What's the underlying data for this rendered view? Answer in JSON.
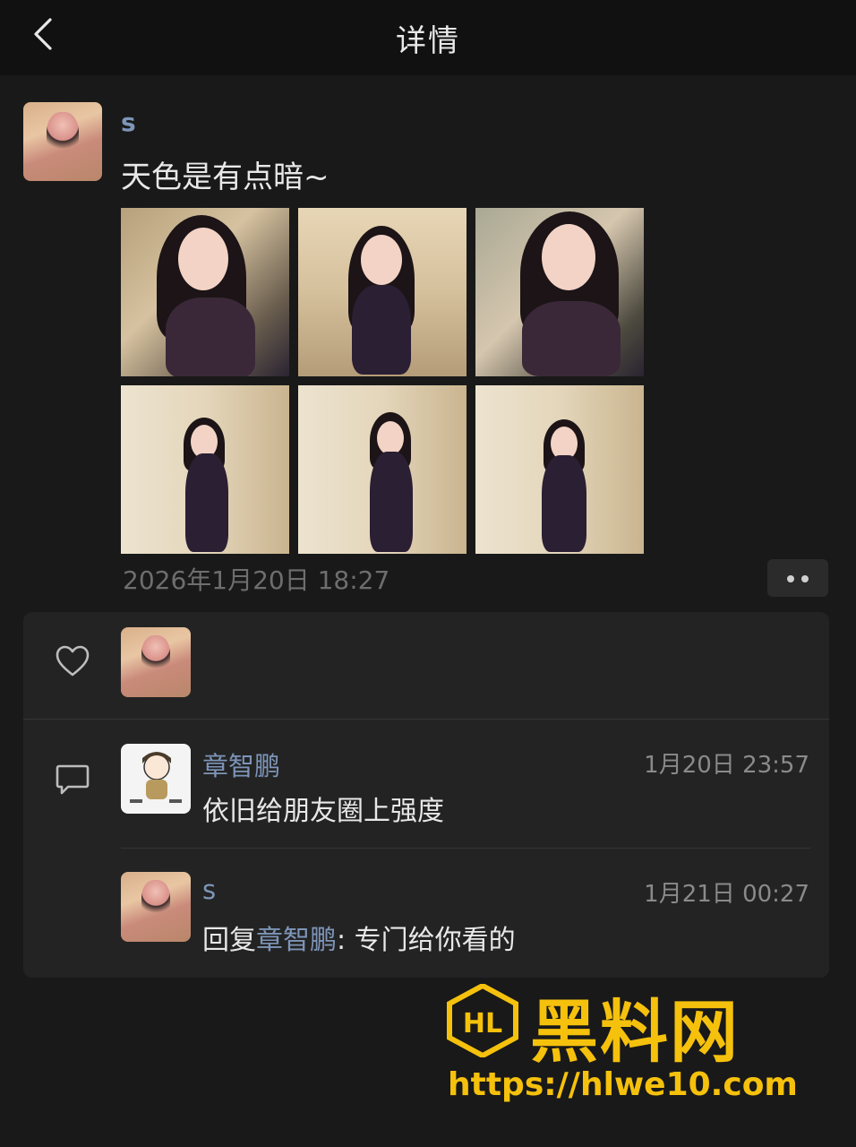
{
  "header": {
    "title": "详情",
    "back_icon": "chevron-left-icon"
  },
  "post": {
    "author": "s",
    "text": "天色是有点暗~",
    "photo_count": 6,
    "timestamp": "2026年1月20日 18:27",
    "more_icon": "more-dots-icon"
  },
  "interactions": {
    "like_icon": "heart-outline-icon",
    "comment_icon": "comment-bubble-icon",
    "comments": [
      {
        "author": "章智鹏",
        "time": "1月20日 23:57",
        "text": "依旧给朋友圈上强度"
      },
      {
        "author": "s",
        "time": "1月21日 00:27",
        "reply_prefix": "回复",
        "reply_to": "章智鹏",
        "reply_sep": ": ",
        "text": "专门给你看的"
      }
    ]
  },
  "watermark": {
    "title": "黑料网",
    "url": "https://hlwe10.com",
    "color": "#f5c10c"
  },
  "colors": {
    "background": "#191919",
    "name_link": "#7d95b8",
    "panel": "#232323"
  }
}
